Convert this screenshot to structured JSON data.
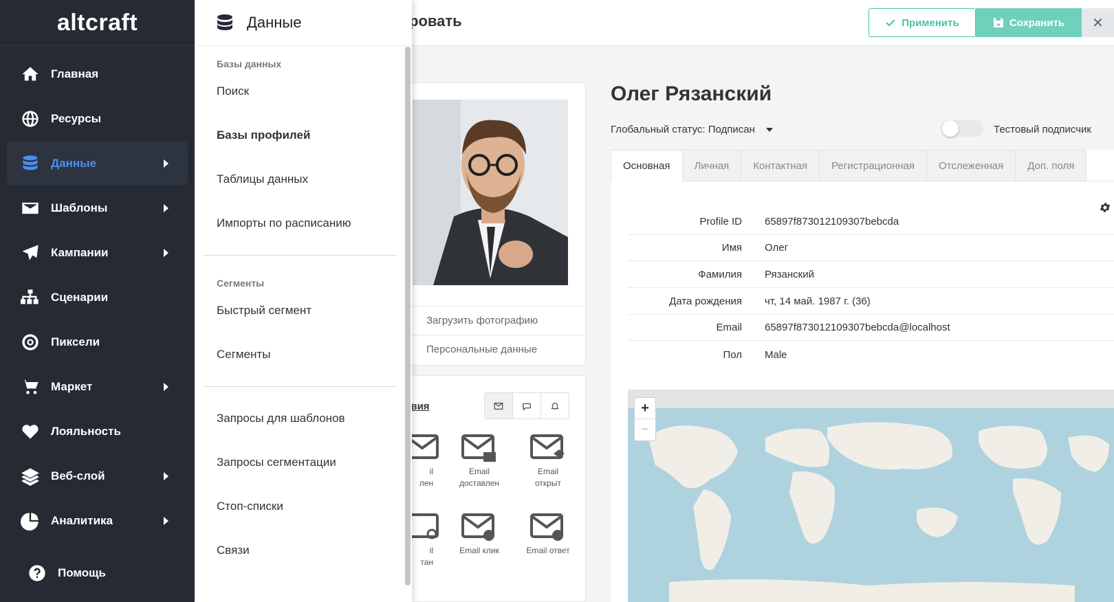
{
  "app": {
    "logo_text": "altcraft"
  },
  "sidebar": {
    "items": [
      {
        "label": "Главная",
        "icon": "home-icon",
        "has_caret": false
      },
      {
        "label": "Ресурсы",
        "icon": "globe-icon",
        "has_caret": false
      },
      {
        "label": "Данные",
        "icon": "database-icon",
        "has_caret": true,
        "active": true
      },
      {
        "label": "Шаблоны",
        "icon": "envelope-icon",
        "has_caret": true
      },
      {
        "label": "Кампании",
        "icon": "paper-plane-icon",
        "has_caret": true
      },
      {
        "label": "Сценарии",
        "icon": "sitemap-icon",
        "has_caret": false
      },
      {
        "label": "Пиксели",
        "icon": "target-icon",
        "has_caret": false
      },
      {
        "label": "Маркет",
        "icon": "cart-icon",
        "has_caret": true
      },
      {
        "label": "Лояльность",
        "icon": "heart-icon",
        "has_caret": false
      },
      {
        "label": "Веб-слой",
        "icon": "layers-icon",
        "has_caret": true
      },
      {
        "label": "Аналитика",
        "icon": "pie-chart-icon",
        "has_caret": true
      }
    ],
    "help_label": "Помощь",
    "active_color": "#4b8ef1"
  },
  "dropdown": {
    "title": "Данные",
    "section1": "Базы данных",
    "group1": [
      "Поиск",
      "Базы профилей",
      "Таблицы данных",
      "Импорты по расписанию"
    ],
    "section2": "Сегменты",
    "group2": [
      "Быстрый сегмент",
      "Сегменты"
    ],
    "group3": [
      "Запросы для шаблонов",
      "Запросы сегментации",
      "Стоп-списки",
      "Связи"
    ]
  },
  "topbar": {
    "title_partial": "ровать",
    "apply_label": "Применить",
    "save_label": "Сохранить",
    "close_label": "✕",
    "accent_color": "#48c2a9"
  },
  "profile": {
    "upload_photo": "Загрузить фотографию",
    "personal_data": "Персональные данные",
    "actions_title": "твия",
    "events": [
      {
        "line1": "il",
        "line2": "лен"
      },
      {
        "line1": "Email",
        "line2": "доставлен"
      },
      {
        "line1": "Email",
        "line2": "открыт"
      },
      {
        "line1": "il",
        "line2": "тан"
      },
      {
        "line1": "Email клик",
        "line2": ""
      },
      {
        "line1": "Email ответ",
        "line2": ""
      }
    ],
    "name": "Олег Рязанский",
    "global_status_label": "Глобальный статус:",
    "global_status_value": "Подписан",
    "test_subscriber": "Тестовый подписчик",
    "tabs": [
      "Основная",
      "Личная",
      "Контактная",
      "Регистрационная",
      "Отслеженная",
      "Доп. поля"
    ],
    "fields": [
      {
        "key": "Profile ID",
        "value": "65897f873012109307bebcda"
      },
      {
        "key": "Имя",
        "value": "Олег"
      },
      {
        "key": "Фамилия",
        "value": "Рязанский"
      },
      {
        "key": "Дата рождения",
        "value": "чт, 14 май. 1987 г. (36)"
      },
      {
        "key": "Email",
        "value": "65897f873012109307bebcda@localhost"
      },
      {
        "key": "Пол",
        "value": "Male"
      }
    ],
    "map_zoom_in": "+",
    "map_zoom_out": "−"
  }
}
